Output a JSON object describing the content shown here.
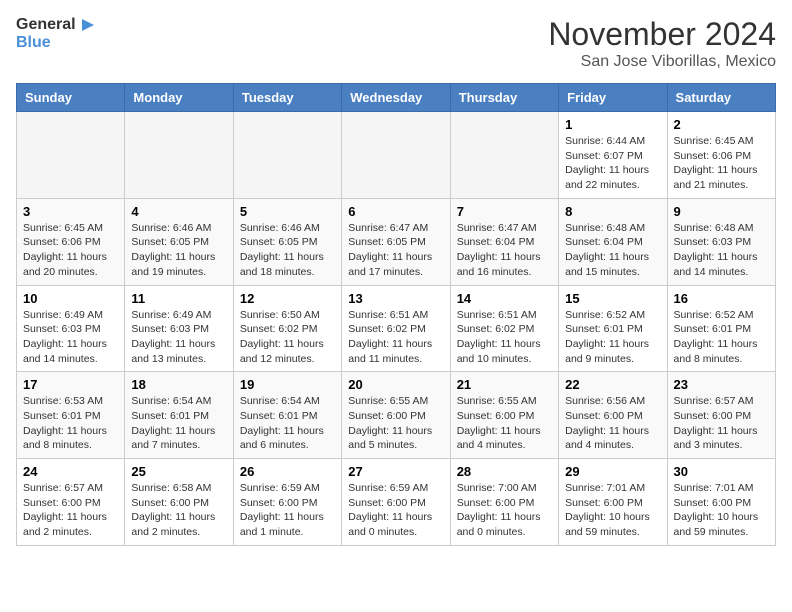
{
  "header": {
    "logo_general": "General",
    "logo_blue": "Blue",
    "main_title": "November 2024",
    "sub_title": "San Jose Viborillas, Mexico"
  },
  "calendar": {
    "days_of_week": [
      "Sunday",
      "Monday",
      "Tuesday",
      "Wednesday",
      "Thursday",
      "Friday",
      "Saturday"
    ],
    "weeks": [
      [
        {
          "day": "",
          "info": ""
        },
        {
          "day": "",
          "info": ""
        },
        {
          "day": "",
          "info": ""
        },
        {
          "day": "",
          "info": ""
        },
        {
          "day": "",
          "info": ""
        },
        {
          "day": "1",
          "info": "Sunrise: 6:44 AM\nSunset: 6:07 PM\nDaylight: 11 hours and 22 minutes."
        },
        {
          "day": "2",
          "info": "Sunrise: 6:45 AM\nSunset: 6:06 PM\nDaylight: 11 hours and 21 minutes."
        }
      ],
      [
        {
          "day": "3",
          "info": "Sunrise: 6:45 AM\nSunset: 6:06 PM\nDaylight: 11 hours and 20 minutes."
        },
        {
          "day": "4",
          "info": "Sunrise: 6:46 AM\nSunset: 6:05 PM\nDaylight: 11 hours and 19 minutes."
        },
        {
          "day": "5",
          "info": "Sunrise: 6:46 AM\nSunset: 6:05 PM\nDaylight: 11 hours and 18 minutes."
        },
        {
          "day": "6",
          "info": "Sunrise: 6:47 AM\nSunset: 6:05 PM\nDaylight: 11 hours and 17 minutes."
        },
        {
          "day": "7",
          "info": "Sunrise: 6:47 AM\nSunset: 6:04 PM\nDaylight: 11 hours and 16 minutes."
        },
        {
          "day": "8",
          "info": "Sunrise: 6:48 AM\nSunset: 6:04 PM\nDaylight: 11 hours and 15 minutes."
        },
        {
          "day": "9",
          "info": "Sunrise: 6:48 AM\nSunset: 6:03 PM\nDaylight: 11 hours and 14 minutes."
        }
      ],
      [
        {
          "day": "10",
          "info": "Sunrise: 6:49 AM\nSunset: 6:03 PM\nDaylight: 11 hours and 14 minutes."
        },
        {
          "day": "11",
          "info": "Sunrise: 6:49 AM\nSunset: 6:03 PM\nDaylight: 11 hours and 13 minutes."
        },
        {
          "day": "12",
          "info": "Sunrise: 6:50 AM\nSunset: 6:02 PM\nDaylight: 11 hours and 12 minutes."
        },
        {
          "day": "13",
          "info": "Sunrise: 6:51 AM\nSunset: 6:02 PM\nDaylight: 11 hours and 11 minutes."
        },
        {
          "day": "14",
          "info": "Sunrise: 6:51 AM\nSunset: 6:02 PM\nDaylight: 11 hours and 10 minutes."
        },
        {
          "day": "15",
          "info": "Sunrise: 6:52 AM\nSunset: 6:01 PM\nDaylight: 11 hours and 9 minutes."
        },
        {
          "day": "16",
          "info": "Sunrise: 6:52 AM\nSunset: 6:01 PM\nDaylight: 11 hours and 8 minutes."
        }
      ],
      [
        {
          "day": "17",
          "info": "Sunrise: 6:53 AM\nSunset: 6:01 PM\nDaylight: 11 hours and 8 minutes."
        },
        {
          "day": "18",
          "info": "Sunrise: 6:54 AM\nSunset: 6:01 PM\nDaylight: 11 hours and 7 minutes."
        },
        {
          "day": "19",
          "info": "Sunrise: 6:54 AM\nSunset: 6:01 PM\nDaylight: 11 hours and 6 minutes."
        },
        {
          "day": "20",
          "info": "Sunrise: 6:55 AM\nSunset: 6:00 PM\nDaylight: 11 hours and 5 minutes."
        },
        {
          "day": "21",
          "info": "Sunrise: 6:55 AM\nSunset: 6:00 PM\nDaylight: 11 hours and 4 minutes."
        },
        {
          "day": "22",
          "info": "Sunrise: 6:56 AM\nSunset: 6:00 PM\nDaylight: 11 hours and 4 minutes."
        },
        {
          "day": "23",
          "info": "Sunrise: 6:57 AM\nSunset: 6:00 PM\nDaylight: 11 hours and 3 minutes."
        }
      ],
      [
        {
          "day": "24",
          "info": "Sunrise: 6:57 AM\nSunset: 6:00 PM\nDaylight: 11 hours and 2 minutes."
        },
        {
          "day": "25",
          "info": "Sunrise: 6:58 AM\nSunset: 6:00 PM\nDaylight: 11 hours and 2 minutes."
        },
        {
          "day": "26",
          "info": "Sunrise: 6:59 AM\nSunset: 6:00 PM\nDaylight: 11 hours and 1 minute."
        },
        {
          "day": "27",
          "info": "Sunrise: 6:59 AM\nSunset: 6:00 PM\nDaylight: 11 hours and 0 minutes."
        },
        {
          "day": "28",
          "info": "Sunrise: 7:00 AM\nSunset: 6:00 PM\nDaylight: 11 hours and 0 minutes."
        },
        {
          "day": "29",
          "info": "Sunrise: 7:01 AM\nSunset: 6:00 PM\nDaylight: 10 hours and 59 minutes."
        },
        {
          "day": "30",
          "info": "Sunrise: 7:01 AM\nSunset: 6:00 PM\nDaylight: 10 hours and 59 minutes."
        }
      ]
    ]
  }
}
